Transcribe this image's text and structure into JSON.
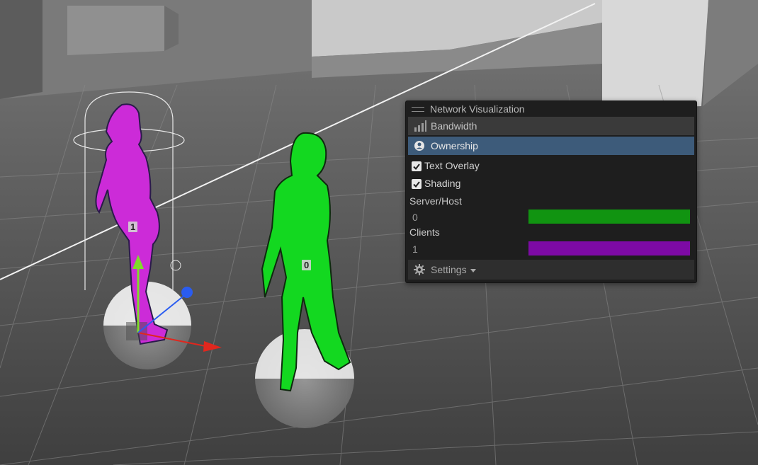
{
  "panel": {
    "title": "Network Visualization",
    "modes": [
      {
        "label": "Bandwidth",
        "icon": "bandwidth-bars-icon",
        "selected": false
      },
      {
        "label": "Ownership",
        "icon": "ownership-user-icon",
        "selected": true
      }
    ],
    "options": [
      {
        "label": "Text Overlay",
        "checked": true
      },
      {
        "label": "Shading",
        "checked": true
      }
    ],
    "legend": [
      {
        "label": "Server/Host",
        "value": "0",
        "color": "#119411"
      },
      {
        "label": "Clients",
        "value": "1",
        "color": "#7d0aa5"
      }
    ],
    "settings": {
      "label": "Settings",
      "icon": "gear-icon"
    }
  },
  "scene": {
    "client_player": {
      "owner_id": "1",
      "color": "#cc2bd8"
    },
    "host_player": {
      "owner_id": "0",
      "color": "#13d820"
    },
    "gizmo_colors": {
      "y_axis": "#7fdc2a",
      "x_axis": "#e0271e",
      "z_axis": "#2a5cf0"
    }
  }
}
